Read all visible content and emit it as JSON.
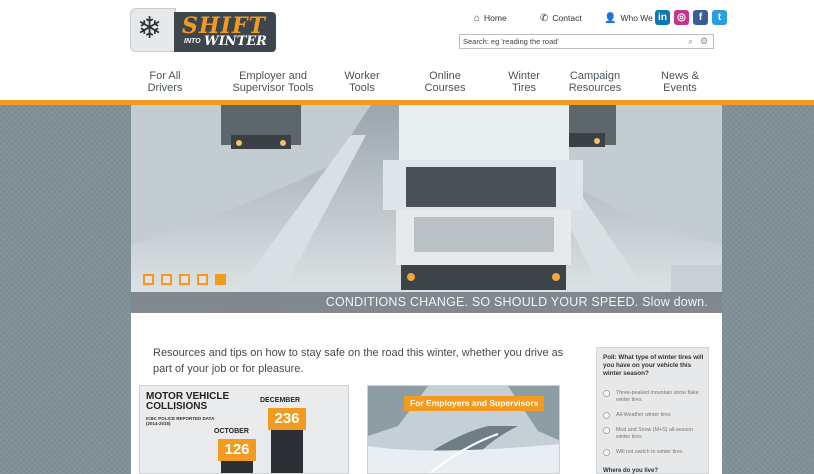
{
  "brand": {
    "logo_line1": "SHIFT",
    "logo_into": "INTO",
    "logo_line2": "WINTER",
    "accent": "#f39a21",
    "dark": "#3d464c"
  },
  "toplinks": {
    "home": "Home",
    "contact": "Contact",
    "who": "Who We Are"
  },
  "social": [
    "linkedin-icon",
    "instagram-icon",
    "facebook-icon",
    "twitter-icon"
  ],
  "search": {
    "value": "Search: eg 'reading the road'"
  },
  "nav": [
    {
      "line1": "For All",
      "line2": "Drivers"
    },
    {
      "line1": "Employer and",
      "line2": "Supervisor Tools"
    },
    {
      "line1": "Worker",
      "line2": "Tools"
    },
    {
      "line1": "Online",
      "line2": "Courses"
    },
    {
      "line1": "Winter",
      "line2": "Tires"
    },
    {
      "line1": "Campaign",
      "line2": "Resources"
    },
    {
      "line1": "News &",
      "line2": "Events"
    }
  ],
  "hero": {
    "caption": "CONDITIONS CHANGE. SO SHOULD YOUR SPEED. Slow down.",
    "slides": 5,
    "active_slide": 5
  },
  "intro": "Resources and tips on how to stay safe on the road this winter, whether you drive as part of your job or for pleasure.",
  "card1": {
    "title": "MOTOR VEHICLE COLLISIONS",
    "source": "ICBC POLICE REPORTED DATA (2014-2015)",
    "month_a": "DECEMBER",
    "value_a": "236",
    "month_b": "OCTOBER",
    "value_b": "126"
  },
  "card2": {
    "badge": "For Employers and Supervisors"
  },
  "poll": {
    "question": "Poll: What type of winter tires will you have on your vehicle this winter season?",
    "options": [
      "Three-peaked mountain snow flake winter tires",
      "All-Weather winter tires",
      "Mud and Snow (M+S) all-season winter tires",
      "Will not switch to winter tires"
    ],
    "question2": "Where do you live?"
  }
}
